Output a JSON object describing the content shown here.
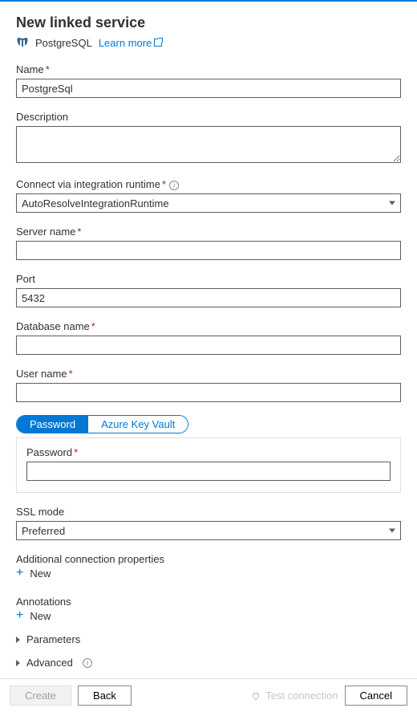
{
  "header": {
    "title": "New linked service",
    "service_name": "PostgreSQL",
    "learn_more": "Learn more"
  },
  "fields": {
    "name": {
      "label": "Name",
      "value": "PostgreSql",
      "required": true
    },
    "description": {
      "label": "Description",
      "value": ""
    },
    "runtime": {
      "label": "Connect via integration runtime",
      "value": "AutoResolveIntegrationRuntime",
      "required": true
    },
    "server": {
      "label": "Server name",
      "value": "",
      "required": true
    },
    "port": {
      "label": "Port",
      "value": "5432"
    },
    "database": {
      "label": "Database name",
      "value": "",
      "required": true
    },
    "username": {
      "label": "User name",
      "value": "",
      "required": true
    },
    "password_tab": {
      "opt1": "Password",
      "opt2": "Azure Key Vault",
      "label": "Password",
      "value": "",
      "required": true
    },
    "sslmode": {
      "label": "SSL mode",
      "value": "Preferred"
    }
  },
  "sections": {
    "additional": {
      "label": "Additional connection properties",
      "new": "New"
    },
    "annotations": {
      "label": "Annotations",
      "new": "New"
    },
    "parameters": {
      "label": "Parameters"
    },
    "advanced": {
      "label": "Advanced"
    }
  },
  "footer": {
    "create": "Create",
    "back": "Back",
    "test": "Test connection",
    "cancel": "Cancel"
  }
}
